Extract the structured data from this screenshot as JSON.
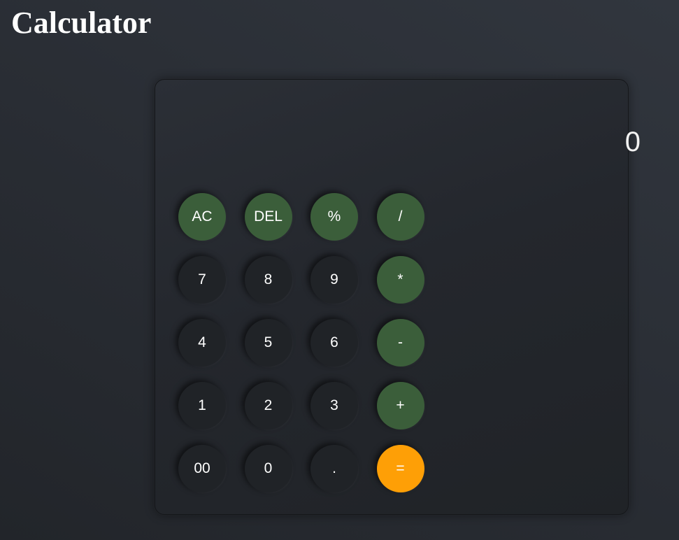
{
  "page": {
    "title": "Calculator"
  },
  "display": {
    "value": "0"
  },
  "colors": {
    "operator_key": "#3b5e3a",
    "number_key": "#202327",
    "equals_key": "#fe9f06",
    "panel": "#24272d"
  },
  "keys": [
    {
      "label": "AC",
      "kind": "op"
    },
    {
      "label": "DEL",
      "kind": "op"
    },
    {
      "label": "%",
      "kind": "op"
    },
    {
      "label": "/",
      "kind": "op"
    },
    {
      "label": "7",
      "kind": "num"
    },
    {
      "label": "8",
      "kind": "num"
    },
    {
      "label": "9",
      "kind": "num"
    },
    {
      "label": "*",
      "kind": "op"
    },
    {
      "label": "4",
      "kind": "num"
    },
    {
      "label": "5",
      "kind": "num"
    },
    {
      "label": "6",
      "kind": "num"
    },
    {
      "label": "-",
      "kind": "op"
    },
    {
      "label": "1",
      "kind": "num"
    },
    {
      "label": "2",
      "kind": "num"
    },
    {
      "label": "3",
      "kind": "num"
    },
    {
      "label": "+",
      "kind": "op"
    },
    {
      "label": "00",
      "kind": "num"
    },
    {
      "label": "0",
      "kind": "num"
    },
    {
      "label": ".",
      "kind": "num"
    },
    {
      "label": "=",
      "kind": "eq"
    }
  ]
}
